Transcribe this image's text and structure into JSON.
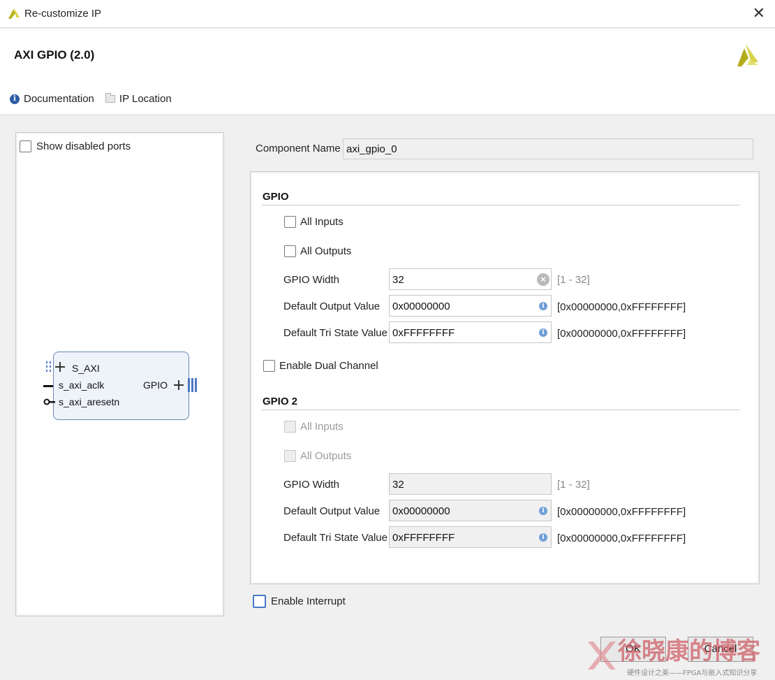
{
  "window": {
    "title": "Re-customize IP"
  },
  "header": {
    "ip_title": "AXI GPIO (2.0)",
    "documentation_label": "Documentation",
    "ip_location_label": "IP Location"
  },
  "left_panel": {
    "show_disabled_ports_label": "Show disabled ports",
    "block": {
      "ports_left": [
        "S_AXI",
        "s_axi_aclk",
        "s_axi_aresetn"
      ],
      "port_right": "GPIO"
    }
  },
  "component": {
    "label": "Component Name",
    "value": "axi_gpio_0"
  },
  "gpio": {
    "title": "GPIO",
    "all_inputs_label": "All Inputs",
    "all_outputs_label": "All Outputs",
    "width_label": "GPIO Width",
    "width_value": "32",
    "width_range": "[1 - 32]",
    "default_output_label": "Default Output Value",
    "default_output_value": "0x00000000",
    "default_output_range": "[0x00000000,0xFFFFFFFF]",
    "default_tri_label": "Default Tri State Value",
    "default_tri_value": "0xFFFFFFFF",
    "default_tri_range": "[0x00000000,0xFFFFFFFF]"
  },
  "enable_dual_channel_label": "Enable Dual Channel",
  "gpio2": {
    "title": "GPIO 2",
    "all_inputs_label": "All Inputs",
    "all_outputs_label": "All Outputs",
    "width_label": "GPIO Width",
    "width_value": "32",
    "width_range": "[1 - 32]",
    "default_output_label": "Default Output Value",
    "default_output_value": "0x00000000",
    "default_output_range": "[0x00000000,0xFFFFFFFF]",
    "default_tri_label": "Default Tri State Value",
    "default_tri_value": "0xFFFFFFFF",
    "default_tri_range": "[0x00000000,0xFFFFFFFF]"
  },
  "enable_interrupt_label": "Enable Interrupt",
  "buttons": {
    "ok": "OK",
    "cancel": "Cancel"
  },
  "watermark": {
    "text": "徐晓康的博客",
    "subtext": "硬件设计之美——FPGA与嵌入式知识分享"
  },
  "colors": {
    "accent": "#4a78c5",
    "block_fill": "#eef3fa",
    "brand_yellow": "#c9c332"
  }
}
